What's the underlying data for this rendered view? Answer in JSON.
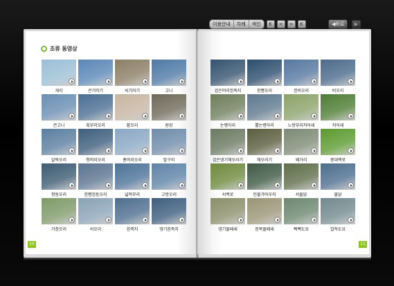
{
  "nav": {
    "menu": [
      {
        "label": "이용안내"
      },
      {
        "label": "차례"
      },
      {
        "label": "색인"
      }
    ],
    "page_buttons": [
      {
        "label": "K"
      },
      {
        "label": "<"
      },
      {
        "label": ">"
      },
      {
        "label": "K"
      }
    ],
    "back_label": "◀뒤로",
    "forward_label": "▶"
  },
  "left_page": {
    "title": "조류 동영상",
    "page_number": "10",
    "items": [
      {
        "label": "개리",
        "color": "#9bbfd6"
      },
      {
        "label": "큰기러기",
        "color": "#5b87b7"
      },
      {
        "label": "쇠기러기",
        "color": "#8d7f66"
      },
      {
        "label": "고니",
        "color": "#4f7aa6"
      },
      {
        "label": "큰고니",
        "color": "#6a8fb3"
      },
      {
        "label": "혹부리오리",
        "color": "#4b6f93"
      },
      {
        "label": "황오리",
        "color": "#c7b5a1"
      },
      {
        "label": "원앙",
        "color": "#6f6a5a"
      },
      {
        "label": "알락오리",
        "color": "#5b7fa0"
      },
      {
        "label": "청머리오리",
        "color": "#3f5f7d"
      },
      {
        "label": "홍머리오리",
        "color": "#8aa8c4"
      },
      {
        "label": "발구지",
        "color": "#6f8ca9"
      },
      {
        "label": "청둥오리",
        "color": "#3d5c73"
      },
      {
        "label": "흰뺨검둥오리",
        "color": "#5c7591"
      },
      {
        "label": "넓적부리",
        "color": "#4d7398"
      },
      {
        "label": "고방오리",
        "color": "#5f84a8"
      },
      {
        "label": "가창오리",
        "color": "#7f9a6a"
      },
      {
        "label": "쇠오리",
        "color": "#8aa3b6"
      },
      {
        "label": "흰죽지",
        "color": "#4e6e8f"
      },
      {
        "label": "댕기흰죽지",
        "color": "#3e5e7e"
      }
    ]
  },
  "right_page": {
    "page_number": "11",
    "items": [
      {
        "label": "검은머리흰죽지",
        "color": "#35546f"
      },
      {
        "label": "흰뺨오리",
        "color": "#2d4e6f"
      },
      {
        "label": "흰비오리",
        "color": "#5678a0"
      },
      {
        "label": "비오리",
        "color": "#4b6b8b"
      },
      {
        "label": "논병아리",
        "color": "#6f7f5c"
      },
      {
        "label": "뿔논병아리",
        "color": "#5f7a8f"
      },
      {
        "label": "노랑부리저어새",
        "color": "#8ba36a"
      },
      {
        "label": "저어새",
        "color": "#4f7d35"
      },
      {
        "label": "검은댕기해오라기",
        "color": "#6b7a62"
      },
      {
        "label": "해오라기",
        "color": "#5b5e3e"
      },
      {
        "label": "왜가리",
        "color": "#7d8a74"
      },
      {
        "label": "중대백로",
        "color": "#5c9a2f"
      },
      {
        "label": "쇠백로",
        "color": "#6f8a3e"
      },
      {
        "label": "민물가마우지",
        "color": "#3f5a45"
      },
      {
        "label": "쇠물닭",
        "color": "#5e6e4a"
      },
      {
        "label": "물닭",
        "color": "#4d6e8e"
      },
      {
        "label": "댕기물떼새",
        "color": "#8b8f6a"
      },
      {
        "label": "흰목물떼새",
        "color": "#9a9577"
      },
      {
        "label": "삑삑도요",
        "color": "#6d8870"
      },
      {
        "label": "깝작도요",
        "color": "#728a8f"
      }
    ]
  }
}
